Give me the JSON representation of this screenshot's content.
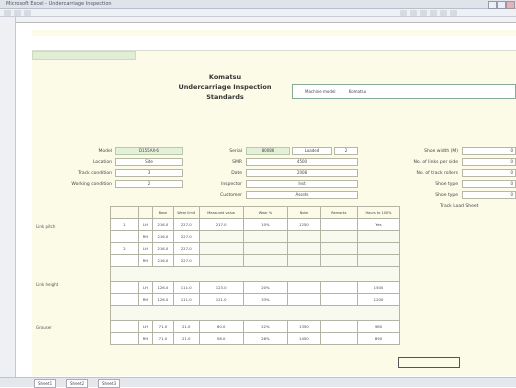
{
  "window": {
    "title": "Microsoft Excel - Undercarriage Inspection"
  },
  "form": {
    "title_lines": [
      "Komatsu",
      "Undercarriage Inspection",
      "Standards"
    ],
    "model_field_label": "Machine model",
    "model_field_value": "Komatsu"
  },
  "info_left": [
    {
      "label": "Model",
      "value": "D155AX-6"
    },
    {
      "label": "Location",
      "value": "Site"
    },
    {
      "label": "Track condition",
      "value": "3"
    },
    {
      "label": "Working condition",
      "value": "2"
    }
  ],
  "info_middle": [
    {
      "label": "Serial",
      "value": "80086",
      "extra": "Loaded",
      "extra2": "2"
    },
    {
      "label": "SMR",
      "value": "4500"
    },
    {
      "label": "Date",
      "value": "2008"
    },
    {
      "label": "Inspector",
      "value": "Inst"
    },
    {
      "label": "Customer",
      "value": "Assets"
    }
  ],
  "info_right": [
    {
      "label": "Shoe width (M)",
      "value": "0"
    },
    {
      "label": "No. of links per side",
      "value": "0"
    },
    {
      "label": "No. of track rollers",
      "value": "0"
    },
    {
      "label": "Shoe type",
      "value": "0"
    },
    {
      "label": "Shoe type",
      "value": "0"
    },
    {
      "label": "Track Load Sheet",
      "value": ""
    }
  ],
  "table": {
    "headers": [
      "",
      "",
      "Base",
      "Wear limit",
      "Measured value",
      "Wear %",
      "Note",
      "Remarks",
      "Hours to 100%"
    ],
    "sections": [
      {
        "label": "Link pitch",
        "rows": [
          [
            "1",
            "LH",
            "216.0",
            "227.0",
            "217.0",
            "10%",
            "1250",
            "",
            "Yes"
          ],
          [
            "",
            "RH",
            "216.0",
            "227.0",
            "",
            "",
            "",
            "",
            ""
          ],
          [
            "2",
            "LH",
            "216.0",
            "227.0",
            "",
            "",
            "",
            "",
            ""
          ],
          [
            "",
            "RH",
            "216.0",
            "227.0",
            "",
            "",
            "",
            "",
            ""
          ]
        ]
      },
      {
        "label": "Link height",
        "rows": [
          [
            "",
            "LH",
            "126.0",
            "111.0",
            "123.0",
            "20%",
            "",
            "",
            "1500"
          ],
          [
            "",
            "RH",
            "126.0",
            "111.0",
            "121.0",
            "33%",
            "",
            "",
            "1200"
          ]
        ]
      },
      {
        "label": "Grouser",
        "rows": [
          [
            "",
            "LH",
            "71.0",
            "21.0",
            "60.0",
            "22%",
            "1350",
            "",
            "980"
          ],
          [
            "",
            "RH",
            "71.0",
            "21.0",
            "58.0",
            "26%",
            "1450",
            "",
            "890"
          ]
        ]
      }
    ]
  },
  "statusbar": {
    "tabs": [
      "Sheet1",
      "Sheet2",
      "Sheet3"
    ]
  }
}
